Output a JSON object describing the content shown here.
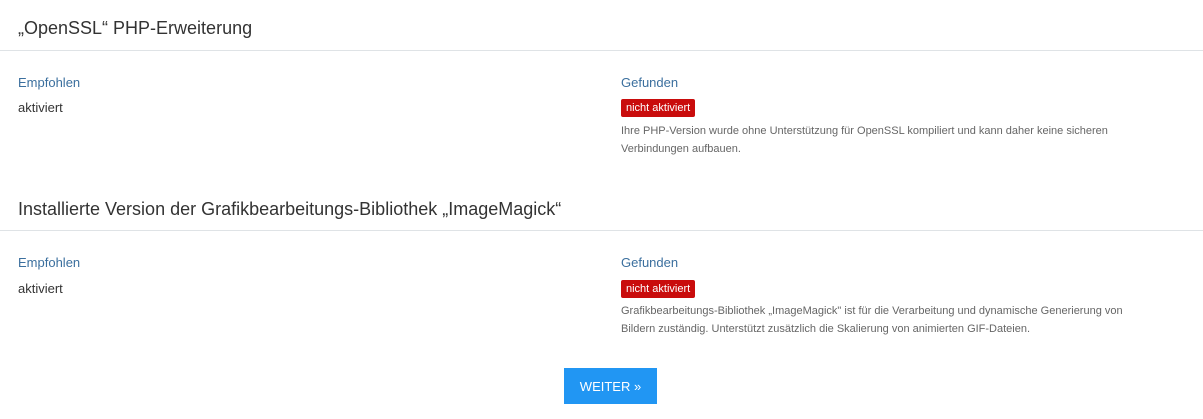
{
  "sections": [
    {
      "title": "„OpenSSL“ PHP-Erweiterung",
      "recommended_label": "Empfohlen",
      "recommended_value": "aktiviert",
      "found_label": "Gefunden",
      "found_status": "nicht aktiviert",
      "description_lines": [
        "Ihre PHP-Version wurde ohne Unterstützung für OpenSSL kompiliert und kann daher keine sicheren",
        "Verbindungen aufbauen."
      ]
    },
    {
      "title": "Installierte Version der Grafikbearbeitungs-Bibliothek „ImageMagick“",
      "recommended_label": "Empfohlen",
      "recommended_value": "aktiviert",
      "found_label": "Gefunden",
      "found_status": "nicht aktiviert",
      "description_lines": [
        "Grafikbearbeitungs-Bibliothek „ImageMagick\" ist für die Verarbeitung und dynamische Generierung von",
        "Bildern zuständig. Unterstützt zusätzlich die Skalierung von animierten GIF-Dateien."
      ]
    }
  ],
  "continue_button": "WEITER »",
  "colors": {
    "label_blue": "#3b6f9e",
    "status_red": "#c90c0c",
    "button_blue": "#2196f3",
    "divider": "#dfe3e6"
  }
}
